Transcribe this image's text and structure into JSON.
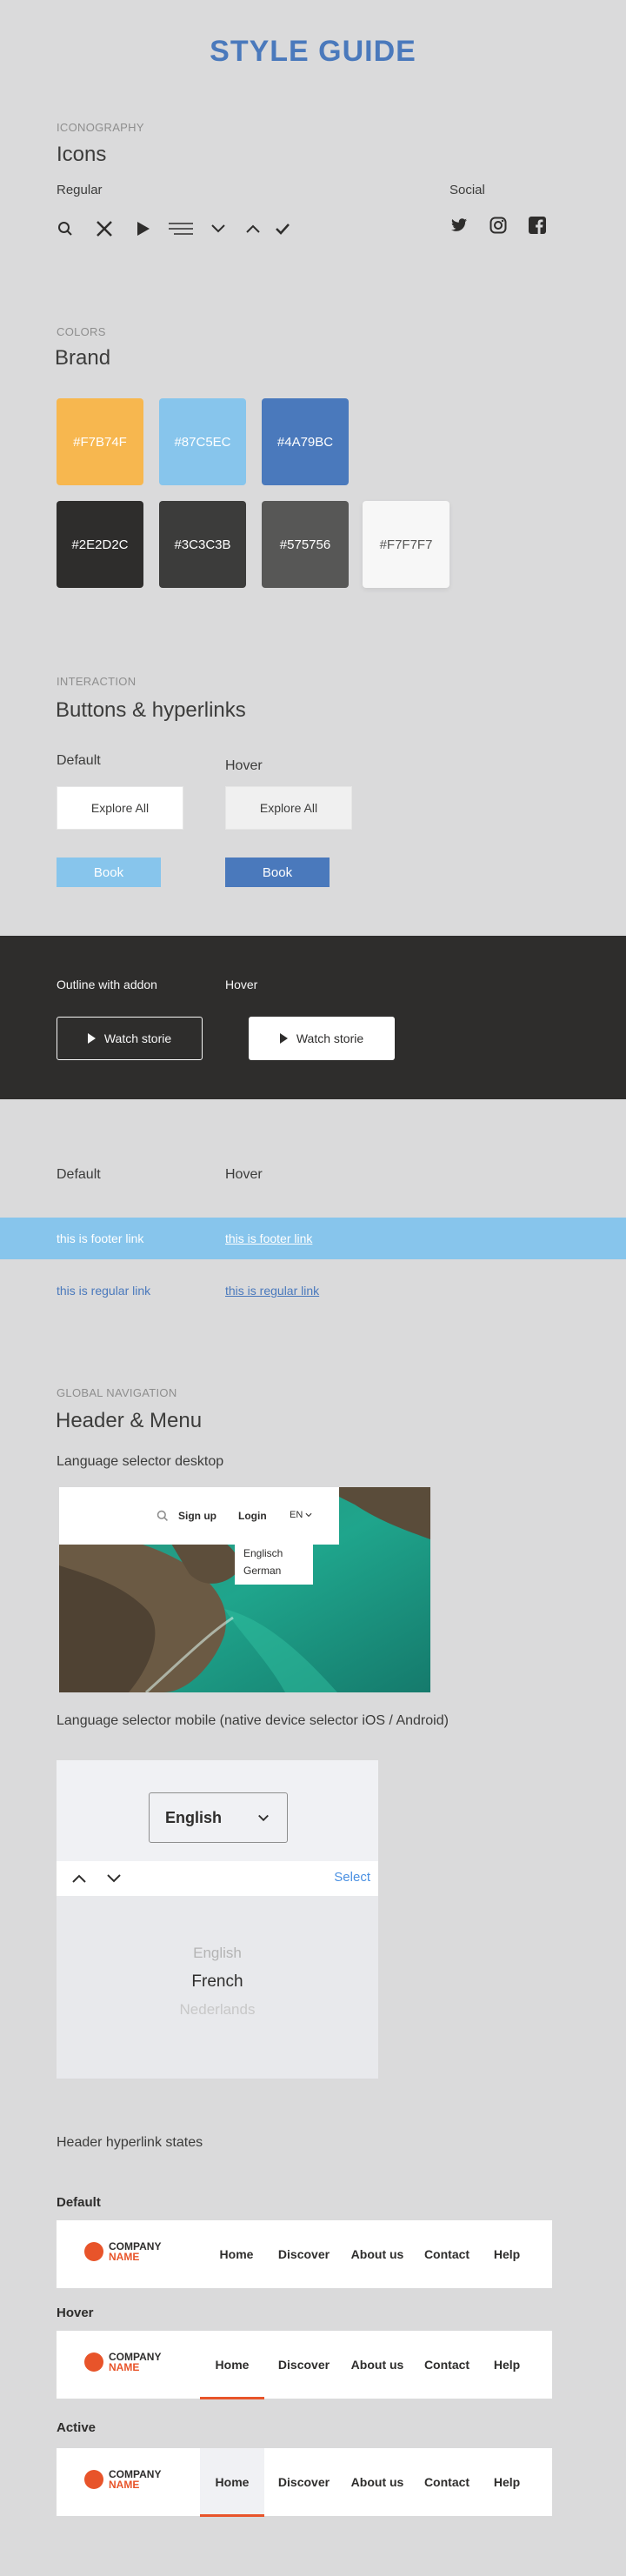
{
  "page_title": "STYLE GUIDE",
  "iconography": {
    "overline": "ICONOGRAPHY",
    "heading": "Icons",
    "regular_label": "Regular",
    "social_label": "Social",
    "regular_icons": [
      "search-icon",
      "close-icon",
      "play-icon",
      "menu-icon",
      "chevron-down-icon",
      "chevron-up-icon",
      "check-icon"
    ],
    "social_icons": [
      "twitter-icon",
      "instagram-icon",
      "facebook-icon"
    ]
  },
  "colors": {
    "overline": "COLORS",
    "heading": "Brand",
    "swatches": [
      {
        "label": "#F7B74F",
        "color": "#F7B74F"
      },
      {
        "label": "#87C5EC",
        "color": "#87C5EC"
      },
      {
        "label": "#4A79BC",
        "color": "#4A79BC"
      },
      {
        "label": "#2E2D2C",
        "color": "#2E2D2C"
      },
      {
        "label": "#3C3C3B",
        "color": "#3C3C3B"
      },
      {
        "label": "#575756",
        "color": "#575756"
      },
      {
        "label": "#F7F7F7",
        "color": "#F7F7F7"
      }
    ]
  },
  "interaction": {
    "overline": "INTERACTION",
    "heading": "Buttons & hyperlinks",
    "default_label": "Default",
    "hover_label": "Hover",
    "explore_label": "Explore All",
    "book_label": "Book",
    "book_color": "#87C5EC",
    "book_hover_color": "#4A79BC"
  },
  "outline_section": {
    "default_label": "Outline with addon",
    "hover_label": "Hover",
    "button_label": "Watch storie"
  },
  "links": {
    "default_label": "Default",
    "hover_label": "Hover",
    "footer_link": "this is footer link",
    "regular_link": "this is regular link"
  },
  "navigation": {
    "overline": "GLOBAL NAVIGATION",
    "heading": "Header & Menu",
    "desktop_label": "Language selector desktop",
    "desktop_bar": {
      "signup": "Sign up",
      "login": "Login",
      "lang": "EN"
    },
    "dropdown_options": [
      "Englisch",
      "German"
    ],
    "mobile_label": "Language selector mobile (native device selector iOS / Android)",
    "mobile": {
      "selected": "English",
      "select_action": "Select",
      "options": [
        "English",
        "French",
        "Nederlands"
      ]
    },
    "states_label": "Header hyperlink states",
    "states": [
      "Default",
      "Hover",
      "Active"
    ],
    "logo": {
      "line1": "COMPANY",
      "line2": "NAME"
    },
    "menu": [
      "Home",
      "Discover",
      "About us",
      "Contact",
      "Help"
    ],
    "accent": "#E8542A"
  }
}
